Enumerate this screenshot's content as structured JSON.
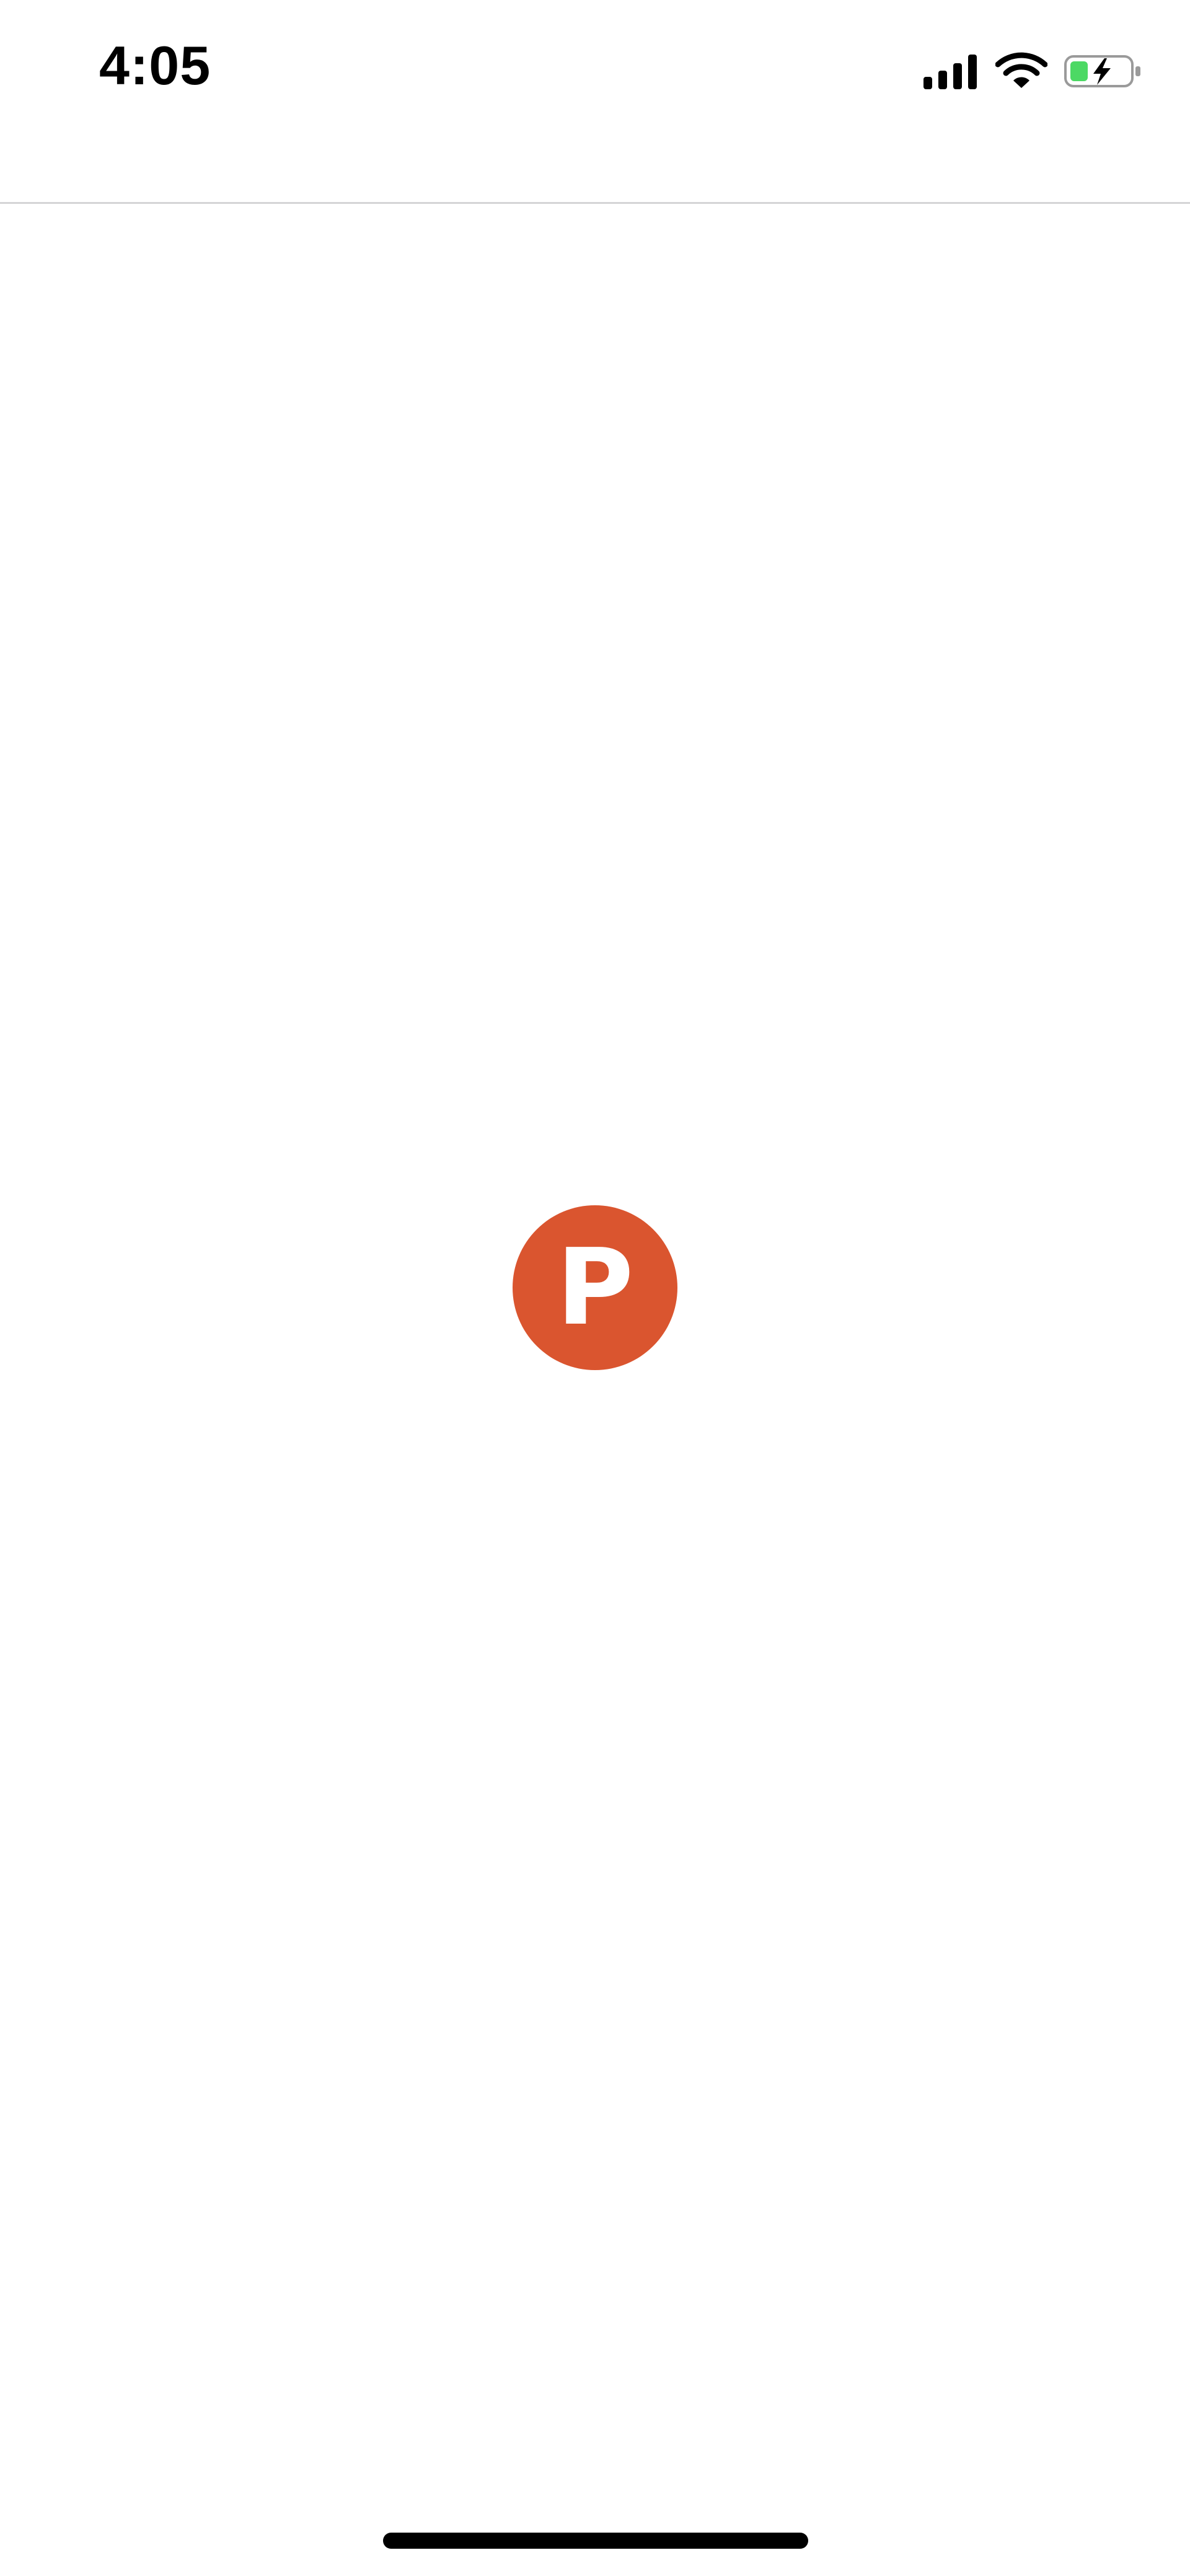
{
  "status_bar": {
    "time": "4:05",
    "icons": [
      "signal-icon",
      "wifi-icon",
      "battery-charging-icon"
    ]
  },
  "splash": {
    "logo_icon": "producthunt-logo-icon",
    "logo_letter": "P"
  },
  "colors": {
    "brand": "#DA552F",
    "battery_fill": "#4CD964",
    "divider": "#D4D4D6"
  }
}
